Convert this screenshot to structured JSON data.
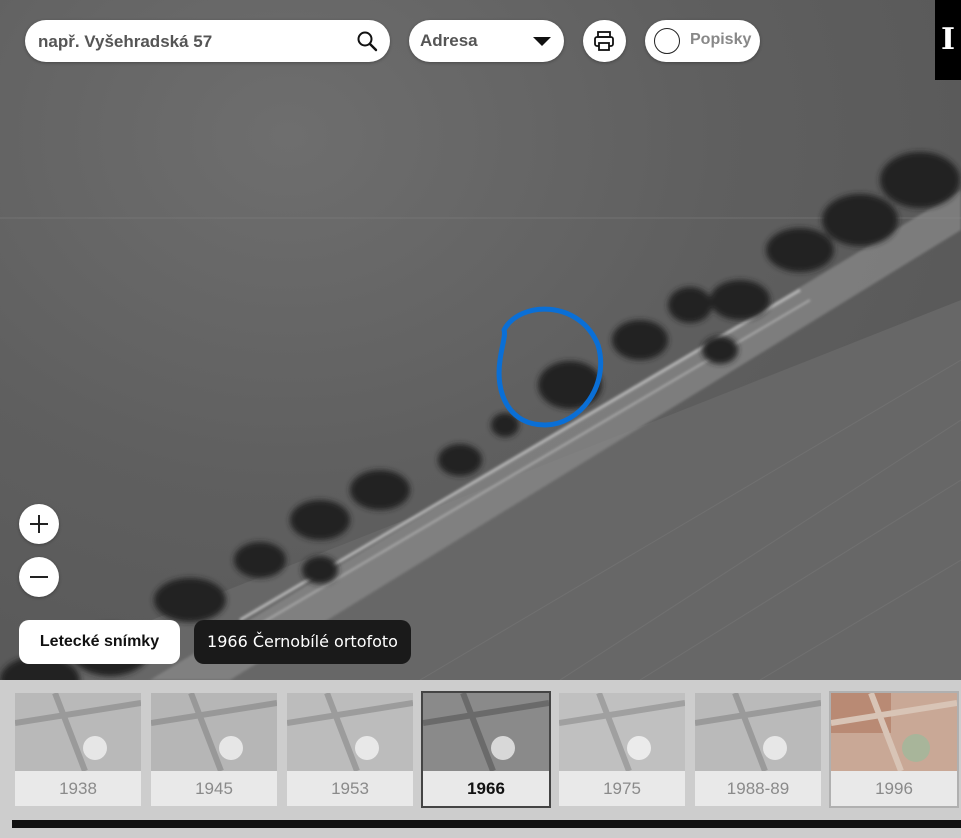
{
  "search": {
    "placeholder": "např. Vyšehradská 57"
  },
  "address_select": {
    "selected": "Adresa"
  },
  "labels_toggle": {
    "label": "Popisky"
  },
  "corner_badge": "I",
  "layer": {
    "button": "Letecké snímky",
    "current": "1966 Černobílé ortofoto"
  },
  "timeline": [
    {
      "year": "1938"
    },
    {
      "year": "1945"
    },
    {
      "year": "1953"
    },
    {
      "year": "1966",
      "active": true
    },
    {
      "year": "1975"
    },
    {
      "year": "1988-89"
    },
    {
      "year": "1996",
      "color": true
    }
  ],
  "colors": {
    "annotation": "#0a6fd6",
    "dark_chip": "#1a1a1a",
    "timeline_bg": "#cdcdcd"
  }
}
